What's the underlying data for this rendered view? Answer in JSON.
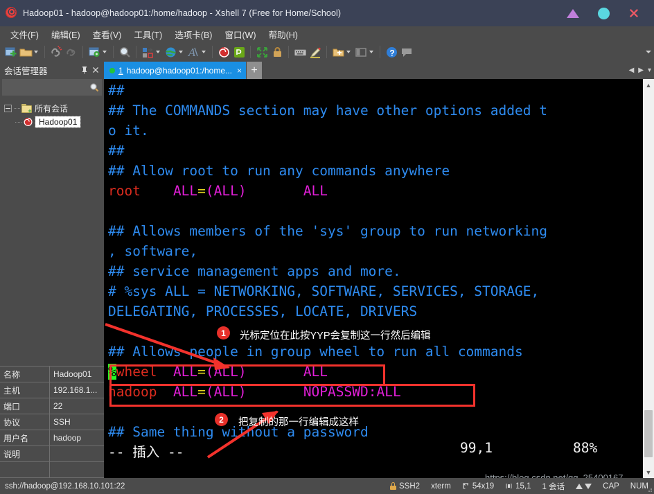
{
  "window": {
    "title": "Hadoop01 - hadoop@hadoop01:/home/hadoop - Xshell 7 (Free for Home/School)",
    "app_icon": "xshell-spiral-icon",
    "controls": {
      "minimize": "minimize-icon",
      "maximize": "maximize-icon",
      "close": "close-icon"
    }
  },
  "menubar": {
    "items": [
      {
        "label": "文件(F)"
      },
      {
        "label": "编辑(E)"
      },
      {
        "label": "查看(V)"
      },
      {
        "label": "工具(T)"
      },
      {
        "label": "选项卡(B)"
      },
      {
        "label": "窗口(W)"
      },
      {
        "label": "帮助(H)"
      }
    ]
  },
  "toolbar": {
    "buttons": [
      {
        "name": "new-session-icon"
      },
      {
        "name": "open-folder-icon",
        "caret": true
      },
      {
        "name": "disconnect-icon"
      },
      {
        "name": "reconnect-icon"
      },
      {
        "name": "session-properties-icon",
        "caret": true
      },
      {
        "name": "find-icon"
      },
      {
        "name": "transfer-icon",
        "caret": true
      },
      {
        "name": "globe-icon",
        "caret": true
      },
      {
        "name": "font-icon",
        "caret": true
      },
      {
        "name": "xshell-icon"
      },
      {
        "name": "xftp-icon"
      },
      {
        "name": "fullscreen-icon"
      },
      {
        "name": "lock-icon"
      },
      {
        "name": "keyboard-icon"
      },
      {
        "name": "highlight-icon"
      },
      {
        "name": "add-to-folder-icon",
        "caret": true
      },
      {
        "name": "layout-icon",
        "caret": true
      },
      {
        "name": "help-icon"
      },
      {
        "name": "feedback-icon"
      }
    ]
  },
  "session_manager": {
    "title": "会话管理器",
    "pin_icon": "pin-icon",
    "close_icon": "close-icon",
    "search": {
      "placeholder": "",
      "value": "",
      "icon": "search-icon"
    },
    "tree": {
      "root": {
        "label": "所有会话",
        "icon": "folder-icon",
        "expanded": true
      },
      "children": [
        {
          "label": "Hadoop01",
          "icon": "session-icon",
          "selected": true
        }
      ]
    },
    "properties": [
      {
        "key": "名称",
        "value": "Hadoop01"
      },
      {
        "key": "主机",
        "value": "192.168.1..."
      },
      {
        "key": "端口",
        "value": "22"
      },
      {
        "key": "协议",
        "value": "SSH"
      },
      {
        "key": "用户名",
        "value": "hadoop"
      },
      {
        "key": "说明",
        "value": ""
      }
    ]
  },
  "tabs": {
    "items": [
      {
        "index": "1",
        "label": "hadoop@hadoop01:/home...",
        "status_dot": "connected",
        "close_icon": "close-icon",
        "active": true
      }
    ],
    "new_tab_label": "+",
    "nav_prev": "◀",
    "nav_next": "▶",
    "nav_list": "▾"
  },
  "terminal": {
    "lines": [
      {
        "segments": [
          {
            "text": "##",
            "style": "comment"
          }
        ]
      },
      {
        "segments": [
          {
            "text": "## The COMMANDS section may have other options added t",
            "style": "comment"
          }
        ]
      },
      {
        "segments": [
          {
            "text": "o it.",
            "style": "comment"
          }
        ]
      },
      {
        "segments": [
          {
            "text": "##",
            "style": "comment"
          }
        ]
      },
      {
        "segments": [
          {
            "text": "## Allow root to run any commands anywhere",
            "style": "comment"
          }
        ]
      },
      {
        "segments": [
          {
            "text": "root",
            "style": "user"
          },
          {
            "text": "    ",
            "style": "plain"
          },
          {
            "text": "ALL=(ALL)",
            "style": "magenta-eq"
          },
          {
            "text": "       ",
            "style": "plain"
          },
          {
            "text": "ALL",
            "style": "magenta"
          }
        ]
      },
      {
        "segments": [
          {
            "text": "",
            "style": "plain"
          }
        ]
      },
      {
        "segments": [
          {
            "text": "## Allows members of the 'sys' group to run networking",
            "style": "comment"
          }
        ]
      },
      {
        "segments": [
          {
            "text": ", software,",
            "style": "comment"
          }
        ]
      },
      {
        "segments": [
          {
            "text": "## service management apps and more.",
            "style": "comment"
          }
        ]
      },
      {
        "segments": [
          {
            "text": "# %sys ALL = NETWORKING, SOFTWARE, SERVICES, STORAGE,",
            "style": "comment"
          }
        ]
      },
      {
        "segments": [
          {
            "text": "DELEGATING, PROCESSES, LOCATE, DRIVERS",
            "style": "comment"
          }
        ]
      },
      {
        "segments": [
          {
            "text": "",
            "style": "plain"
          }
        ]
      },
      {
        "segments": [
          {
            "text": "## Allows people in group wheel to run all commands",
            "style": "comment"
          }
        ]
      },
      {
        "segments": [
          {
            "text": "%",
            "style": "cursor"
          },
          {
            "text": "wheel",
            "style": "user"
          },
          {
            "text": "  ",
            "style": "plain"
          },
          {
            "text": "ALL=(ALL)",
            "style": "magenta-eq"
          },
          {
            "text": "       ",
            "style": "plain"
          },
          {
            "text": "ALL",
            "style": "magenta"
          }
        ]
      },
      {
        "segments": [
          {
            "text": "hadoop",
            "style": "user"
          },
          {
            "text": "  ",
            "style": "plain"
          },
          {
            "text": "ALL=(ALL)",
            "style": "magenta-eq"
          },
          {
            "text": "       ",
            "style": "plain"
          },
          {
            "text": "NOPASSWD:ALL",
            "style": "magenta"
          }
        ]
      },
      {
        "segments": [
          {
            "text": "",
            "style": "plain"
          }
        ]
      },
      {
        "segments": [
          {
            "text": "## Same thing without a password",
            "style": "comment"
          }
        ]
      },
      {
        "segments": [
          {
            "text": "-- 插入 --",
            "style": "white"
          }
        ]
      }
    ],
    "cursor_position": "99,1",
    "scroll_percent": "88%"
  },
  "annotations": [
    {
      "badge": "1",
      "text": "光标定位在此按YYP会复制这一行然后编辑",
      "arrow": "arrow-to-wheel-line"
    },
    {
      "badge": "2",
      "text": "把复制的那一行编辑成这样",
      "arrow": "arrow-to-hadoop-line"
    }
  ],
  "statusbar": {
    "connection": "ssh://hadoop@192.168.10.101:22",
    "security": "SSH2",
    "terminal_type": "xterm",
    "size": "54x19",
    "cursor": "15,1",
    "sessions": "1 会话",
    "caps": "CAP",
    "num": "NUM",
    "lock_icon": "lock-icon",
    "resize_icon": "resize-icon",
    "cursor_icon": "cursor-icon",
    "up_icon": "arrow-up-icon",
    "down_icon": "arrow-down-icon"
  },
  "watermark": {
    "text": "https://blog.csdn.net/qq_25400167"
  },
  "colors": {
    "titlebar_bg": "#3b4256",
    "chrome_bg": "#4b4b4b",
    "tab_active": "#1a8fe3",
    "terminal_bg": "#000000",
    "comment": "#2e8bf0",
    "user": "#dd2c1f",
    "magenta": "#e21fd8",
    "equals": "#e0d31f",
    "cursor": "#24fa24",
    "annotation_red": "#f3322c"
  }
}
